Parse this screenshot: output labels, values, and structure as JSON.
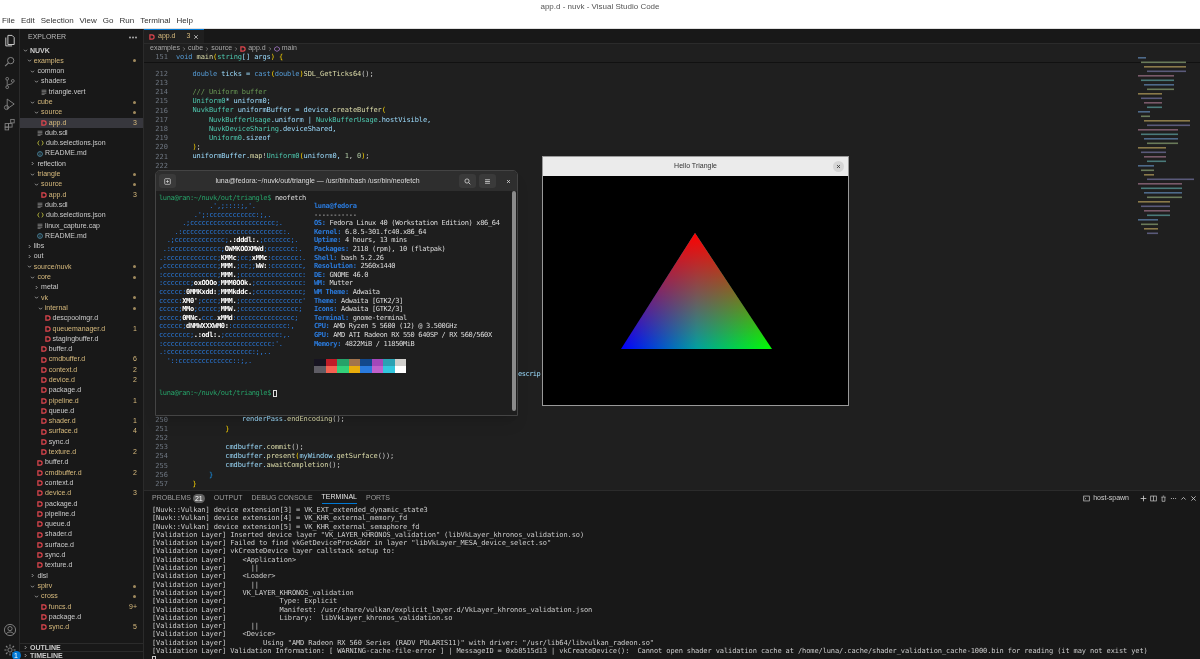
{
  "window": {
    "title": "app.d - nuvk - Visual Studio Code"
  },
  "menu": [
    "File",
    "Edit",
    "Selection",
    "View",
    "Go",
    "Run",
    "Terminal",
    "Help"
  ],
  "activity_bar": [
    {
      "kind": "files",
      "selected": true
    },
    {
      "kind": "search",
      "selected": false
    },
    {
      "kind": "source_control",
      "selected": false
    },
    {
      "kind": "run_debug",
      "selected": false
    },
    {
      "kind": "extensions",
      "selected": false
    }
  ],
  "activity_bottom": [
    {
      "kind": "account"
    },
    {
      "kind": "settings",
      "badge": "1"
    }
  ],
  "sidebar": {
    "title": "EXPLORER",
    "tree": [
      {
        "label": "NUVK",
        "kind": "root",
        "expanded": true,
        "modified": false,
        "selected": false,
        "children": [
          {
            "label": "examples",
            "kind": "folder",
            "expanded": true,
            "modified": true,
            "selected": false,
            "children": [
              {
                "label": "common",
                "kind": "folder",
                "expanded": true,
                "modified": false,
                "selected": false,
                "children": [
                  {
                    "label": "shaders",
                    "kind": "folder",
                    "expanded": true,
                    "modified": false,
                    "selected": false,
                    "children": [
                      {
                        "label": "triangle.vert",
                        "kind": "lines",
                        "modified": false,
                        "selected": false
                      }
                    ]
                  }
                ]
              },
              {
                "label": "cube",
                "kind": "folder",
                "expanded": true,
                "modified": true,
                "selected": false,
                "children": [
                  {
                    "label": "source",
                    "kind": "folder",
                    "expanded": true,
                    "modified": true,
                    "selected": false,
                    "children": [
                      {
                        "label": "app.d",
                        "kind": "d",
                        "modified": true,
                        "selected": true,
                        "badge": "3"
                      }
                    ]
                  },
                  {
                    "label": "dub.sdl",
                    "kind": "lines",
                    "modified": false,
                    "selected": false
                  },
                  {
                    "label": "dub.selections.json",
                    "kind": "json",
                    "modified": false,
                    "selected": false
                  },
                  {
                    "label": "README.md",
                    "kind": "md",
                    "modified": false,
                    "selected": false
                  }
                ]
              },
              {
                "label": "reflection",
                "kind": "folder",
                "expanded": false,
                "modified": false,
                "selected": false
              },
              {
                "label": "triangle",
                "kind": "folder",
                "expanded": true,
                "modified": true,
                "selected": false,
                "children": [
                  {
                    "label": "source",
                    "kind": "folder",
                    "expanded": true,
                    "modified": true,
                    "selected": false,
                    "children": [
                      {
                        "label": "app.d",
                        "kind": "d",
                        "modified": true,
                        "selected": false,
                        "badge": "3"
                      }
                    ]
                  },
                  {
                    "label": "dub.sdl",
                    "kind": "lines",
                    "modified": false,
                    "selected": false
                  },
                  {
                    "label": "dub.selections.json",
                    "kind": "json",
                    "modified": false,
                    "selected": false
                  },
                  {
                    "label": "linux_capture.cap",
                    "kind": "lines",
                    "modified": false,
                    "selected": false
                  },
                  {
                    "label": "README.md",
                    "kind": "md",
                    "modified": false,
                    "selected": false
                  }
                ]
              }
            ]
          },
          {
            "label": "libs",
            "kind": "folder",
            "expanded": false,
            "modified": false,
            "selected": false
          },
          {
            "label": "out",
            "kind": "folder",
            "expanded": false,
            "modified": false,
            "selected": false
          },
          {
            "label": "source/nuvk",
            "kind": "folder",
            "expanded": true,
            "modified": true,
            "selected": false,
            "children": [
              {
                "label": "core",
                "kind": "folder",
                "expanded": true,
                "modified": true,
                "selected": false,
                "children": [
                  {
                    "label": "metal",
                    "kind": "folder",
                    "expanded": false,
                    "modified": false,
                    "selected": false
                  },
                  {
                    "label": "vk",
                    "kind": "folder",
                    "expanded": true,
                    "modified": true,
                    "selected": false,
                    "children": [
                      {
                        "label": "internal",
                        "kind": "folder",
                        "expanded": true,
                        "modified": true,
                        "selected": false,
                        "children": [
                          {
                            "label": "descpoolmgr.d",
                            "kind": "d",
                            "modified": false,
                            "selected": false
                          },
                          {
                            "label": "queuemanager.d",
                            "kind": "d",
                            "modified": true,
                            "selected": false,
                            "badge": "1"
                          },
                          {
                            "label": "stagingbuffer.d",
                            "kind": "d",
                            "modified": false,
                            "selected": false
                          }
                        ]
                      },
                      {
                        "label": "buffer.d",
                        "kind": "d",
                        "modified": false,
                        "selected": false
                      },
                      {
                        "label": "cmdbuffer.d",
                        "kind": "d",
                        "modified": true,
                        "selected": false,
                        "badge": "6"
                      },
                      {
                        "label": "context.d",
                        "kind": "d",
                        "modified": true,
                        "selected": false,
                        "badge": "2"
                      },
                      {
                        "label": "device.d",
                        "kind": "d",
                        "modified": true,
                        "selected": false,
                        "badge": "2"
                      },
                      {
                        "label": "package.d",
                        "kind": "d",
                        "modified": false,
                        "selected": false
                      },
                      {
                        "label": "pipeline.d",
                        "kind": "d",
                        "modified": true,
                        "selected": false,
                        "badge": "1"
                      },
                      {
                        "label": "queue.d",
                        "kind": "d",
                        "modified": false,
                        "selected": false
                      },
                      {
                        "label": "shader.d",
                        "kind": "d",
                        "modified": true,
                        "selected": false,
                        "badge": "1"
                      },
                      {
                        "label": "surface.d",
                        "kind": "d",
                        "modified": true,
                        "selected": false,
                        "badge": "4"
                      },
                      {
                        "label": "sync.d",
                        "kind": "d",
                        "modified": false,
                        "selected": false
                      },
                      {
                        "label": "texture.d",
                        "kind": "d",
                        "modified": true,
                        "selected": false,
                        "badge": "2"
                      }
                    ]
                  },
                  {
                    "label": "buffer.d",
                    "kind": "d",
                    "modified": false,
                    "selected": false
                  },
                  {
                    "label": "cmdbuffer.d",
                    "kind": "d",
                    "modified": true,
                    "selected": false,
                    "badge": "2"
                  },
                  {
                    "label": "context.d",
                    "kind": "d",
                    "modified": false,
                    "selected": false
                  },
                  {
                    "label": "device.d",
                    "kind": "d",
                    "modified": true,
                    "selected": false,
                    "badge": "3"
                  },
                  {
                    "label": "package.d",
                    "kind": "d",
                    "modified": false,
                    "selected": false
                  },
                  {
                    "label": "pipeline.d",
                    "kind": "d",
                    "modified": false,
                    "selected": false
                  },
                  {
                    "label": "queue.d",
                    "kind": "d",
                    "modified": false,
                    "selected": false
                  },
                  {
                    "label": "shader.d",
                    "kind": "d",
                    "modified": false,
                    "selected": false
                  },
                  {
                    "label": "surface.d",
                    "kind": "d",
                    "modified": false,
                    "selected": false
                  },
                  {
                    "label": "sync.d",
                    "kind": "d",
                    "modified": false,
                    "selected": false
                  },
                  {
                    "label": "texture.d",
                    "kind": "d",
                    "modified": false,
                    "selected": false
                  }
                ]
              },
              {
                "label": "dlsl",
                "kind": "folder",
                "expanded": false,
                "modified": false,
                "selected": false
              },
              {
                "label": "spirv",
                "kind": "folder",
                "expanded": true,
                "modified": true,
                "selected": false,
                "children": [
                  {
                    "label": "cross",
                    "kind": "folder",
                    "expanded": true,
                    "modified": true,
                    "selected": false,
                    "children": [
                      {
                        "label": "funcs.d",
                        "kind": "d",
                        "modified": true,
                        "selected": false,
                        "badge": "9+"
                      },
                      {
                        "label": "package.d",
                        "kind": "d",
                        "modified": false,
                        "selected": false
                      },
                      {
                        "label": "sync.d",
                        "kind": "d",
                        "modified": true,
                        "selected": false,
                        "badge": "5"
                      }
                    ]
                  }
                ]
              }
            ]
          }
        ]
      }
    ],
    "sections": [
      {
        "label": "OUTLINE",
        "expanded": false
      },
      {
        "label": "TIMELINE",
        "expanded": false
      }
    ]
  },
  "editor": {
    "tabs": [
      {
        "label": "app.d",
        "badge": "3",
        "modified": true,
        "selected": true
      }
    ],
    "breadcrumb": [
      {
        "label": "examples",
        "kind": "folder"
      },
      {
        "label": "cube",
        "kind": "folder"
      },
      {
        "label": "source",
        "kind": "folder"
      },
      {
        "label": "app.d",
        "kind": "d"
      },
      {
        "label": "main",
        "kind": "symbol"
      }
    ],
    "sticky": {
      "number": "151",
      "tokens": [
        {
          "text": "void",
          "kind": "kw"
        },
        {
          "text": " main",
          "kind": "fn"
        },
        {
          "text": "(",
          "kind": "b"
        },
        {
          "text": "string",
          "kind": "type"
        },
        {
          "text": "[] args",
          "kind": "var"
        },
        {
          "text": ") {",
          "kind": "b"
        }
      ]
    },
    "lines": [
      {
        "number": "212",
        "tokens": [
          {
            "text": "    double",
            "kind": "kw"
          },
          {
            "text": " ticks = ",
            "kind": "var"
          },
          {
            "text": "cast",
            "kind": "kw"
          },
          {
            "text": "(",
            "kind": "b"
          },
          {
            "text": "double",
            "kind": "kw"
          },
          {
            "text": ")",
            "kind": "b"
          },
          {
            "text": "SDL_GetTicks64",
            "kind": "fn"
          },
          {
            "text": "();",
            "kind": "p"
          }
        ]
      },
      {
        "number": "213"
      },
      {
        "number": "214",
        "tokens": [
          {
            "text": "    /// Uniform buffer",
            "kind": "cm"
          }
        ]
      },
      {
        "number": "215",
        "tokens": [
          {
            "text": "    Uniform0",
            "kind": "type"
          },
          {
            "text": "* uniform0;",
            "kind": "var"
          }
        ]
      },
      {
        "number": "216",
        "tokens": [
          {
            "text": "    NuvkBuffer",
            "kind": "type"
          },
          {
            "text": " uniformBuffer = device.",
            "kind": "var"
          },
          {
            "text": "createBuffer",
            "kind": "fn"
          },
          {
            "text": "(",
            "kind": "b"
          }
        ]
      },
      {
        "number": "217",
        "tokens": [
          {
            "text": "        NuvkBufferUsage",
            "kind": "type"
          },
          {
            "text": ".uniform | ",
            "kind": "var"
          },
          {
            "text": "NuvkBufferUsage",
            "kind": "type"
          },
          {
            "text": ".hostVisible,",
            "kind": "var"
          }
        ]
      },
      {
        "number": "218",
        "tokens": [
          {
            "text": "        NuvkDeviceSharing",
            "kind": "type"
          },
          {
            "text": ".deviceShared,",
            "kind": "var"
          }
        ]
      },
      {
        "number": "219",
        "tokens": [
          {
            "text": "        Uniform0",
            "kind": "type"
          },
          {
            "text": ".sizeof",
            "kind": "var"
          }
        ]
      },
      {
        "number": "220",
        "tokens": [
          {
            "text": "    )",
            "kind": "b"
          },
          {
            "text": ";",
            "kind": "p"
          }
        ]
      },
      {
        "number": "221",
        "tokens": [
          {
            "text": "    uniformBuffer.",
            "kind": "var"
          },
          {
            "text": "map",
            "kind": "fn"
          },
          {
            "text": "!",
            "kind": "p"
          },
          {
            "text": "Uniform0",
            "kind": "type"
          },
          {
            "text": "(",
            "kind": "b"
          },
          {
            "text": "uniform0, ",
            "kind": "var"
          },
          {
            "text": "1",
            "kind": "num"
          },
          {
            "text": ", ",
            "kind": "p"
          },
          {
            "text": "0",
            "kind": "num"
          },
          {
            "text": ")",
            "kind": "b"
          },
          {
            "text": ";",
            "kind": "p"
          }
        ]
      },
      {
        "number": "222"
      }
    ],
    "lower_lines": [
      {
        "number": "250",
        "tokens": [
          {
            "text": "                renderPass.",
            "kind": "var"
          },
          {
            "text": "endEncoding",
            "kind": "fn"
          },
          {
            "text": "();",
            "kind": "p"
          }
        ]
      },
      {
        "number": "251",
        "tokens": [
          {
            "text": "            }",
            "kind": "b"
          }
        ]
      },
      {
        "number": "252"
      },
      {
        "number": "253",
        "tokens": [
          {
            "text": "            cmdbuffer.",
            "kind": "var"
          },
          {
            "text": "commit",
            "kind": "fn"
          },
          {
            "text": "();",
            "kind": "p"
          }
        ]
      },
      {
        "number": "254",
        "tokens": [
          {
            "text": "            cmdbuffer.",
            "kind": "var"
          },
          {
            "text": "present",
            "kind": "fn"
          },
          {
            "text": "(",
            "kind": "b"
          },
          {
            "text": "myWindow.",
            "kind": "var"
          },
          {
            "text": "getSurface",
            "kind": "fn"
          },
          {
            "text": "());",
            "kind": "p"
          }
        ]
      },
      {
        "number": "255",
        "tokens": [
          {
            "text": "            cmdbuffer.",
            "kind": "var"
          },
          {
            "text": "awaitCompletion",
            "kind": "fn"
          },
          {
            "text": "();",
            "kind": "p"
          }
        ]
      },
      {
        "number": "256",
        "tokens": [
          {
            "text": "        }",
            "kind": "b2"
          }
        ]
      },
      {
        "number": "257",
        "tokens": [
          {
            "text": "    }",
            "kind": "b"
          }
        ]
      }
    ],
    "fragment": "escrip"
  },
  "terminal_window": {
    "title": "luna@fedora:~/nuvk/out/triangle — /usr/bin/bash /usr/bin/neofetch",
    "prompts": [
      {
        "prompt": "luna@ran:~/nuvk/out/triangle$",
        "command": "neofetch"
      },
      {
        "prompt": "luna@ran:~/nuvk/out/triangle$"
      }
    ],
    "art": [
      [
        "             .',;::::;,'."
      ],
      [
        "         .';:cccccccccccc:;,."
      ],
      [
        "      .;cccccccccccccccccccccc;."
      ],
      [
        "    .:cccccccccccccccccccccccccc:."
      ],
      [
        "  .;ccccccccccccc;",
        ".:dddl:.",
        ";ccccccc;."
      ],
      [
        " .:ccccccccccccc;",
        "OWMKOOXMWd",
        ";ccccccc:."
      ],
      [
        ".:ccccccccccccc;",
        "KMMc",
        ";cc;",
        "xMMc",
        ":ccccccc:."
      ],
      [
        ",cccccccccccccc;",
        "MMM.",
        ";cc;;",
        "WW:",
        ":cccccccc,"
      ],
      [
        ":cccccccccccccc;",
        "MMM.",
        ";cccccccccccccccc:"
      ],
      [
        ":ccccccc;",
        "oxOOOo",
        ";",
        "MMM0OOk.",
        ";cccccccccccc:"
      ],
      [
        "cccccc:",
        "0MMKxdd:",
        ";",
        "MMMkddc.",
        ";cccccccccccc;"
      ],
      [
        "ccccc:",
        "XM0'",
        ";cccc;",
        "MMM.",
        ";cccccccccccccccc'"
      ],
      [
        "ccccc;",
        "MMo",
        ";ccccc;",
        "MMW.",
        ";ccccccccccccccc;"
      ],
      [
        "ccccc;",
        "0MNc.",
        "ccc.",
        "xMMd",
        ":ccccccccccccccc;"
      ],
      [
        "cccccc;",
        "dNMWXXXWM0:",
        ":cccccccccccccc:,"
      ],
      [
        "cccccccc;",
        ".:odl:.",
        ";cccccccccccccc:,."
      ],
      [
        ":cccccccccccccccccccccccccccc:'."
      ],
      [
        ".:cccccccccccccccccccccc:;,.."
      ],
      [
        "  '::cccccccccccccc::;,."
      ]
    ],
    "user": "luna@fedora",
    "rule": "-----------",
    "info": [
      {
        "key": "OS:",
        "value": "Fedora Linux 40 (Workstation Edition) x86_64"
      },
      {
        "key": "Kernel:",
        "value": "6.8.5-301.fc40.x86_64"
      },
      {
        "key": "Uptime:",
        "value": "4 hours, 13 mins"
      },
      {
        "key": "Packages:",
        "value": "2118 (rpm), 10 (flatpak)"
      },
      {
        "key": "Shell:",
        "value": "bash 5.2.26"
      },
      {
        "key": "Resolution:",
        "value": "2560x1440"
      },
      {
        "key": "DE:",
        "value": "GNOME 46.0"
      },
      {
        "key": "WM:",
        "value": "Mutter"
      },
      {
        "key": "WM Theme:",
        "value": "Adwaita"
      },
      {
        "key": "Theme:",
        "value": "Adwaita [GTK2/3]"
      },
      {
        "key": "Icons:",
        "value": "Adwaita [GTK2/3]"
      },
      {
        "key": "Terminal:",
        "value": "gnome-terminal"
      },
      {
        "key": "CPU:",
        "value": "AMD Ryzen 5 5600 (12) @ 3.500GHz"
      },
      {
        "key": "GPU:",
        "value": "AMD ATI Radeon RX 550 640SP / RX 560/560X"
      },
      {
        "key": "Memory:",
        "value": "4822MiB / 11850MiB"
      }
    ],
    "palette": [
      {
        "color": "#171421"
      },
      {
        "color": "#c01c28"
      },
      {
        "color": "#26a269"
      },
      {
        "color": "#a2734c"
      },
      {
        "color": "#12488b"
      },
      {
        "color": "#a347ba"
      },
      {
        "color": "#2aa1b3"
      },
      {
        "color": "#d0cfcc"
      },
      {
        "color": "#5e5c64"
      },
      {
        "color": "#f66151"
      },
      {
        "color": "#33d17a"
      },
      {
        "color": "#e9ad0c"
      },
      {
        "color": "#2a7bde"
      },
      {
        "color": "#c061cb"
      },
      {
        "color": "#33c7de"
      },
      {
        "color": "#ffffff"
      }
    ]
  },
  "hello_window": {
    "title": "Hello Triangle"
  },
  "panel": {
    "tabs": [
      {
        "label": "PROBLEMS",
        "badge": "21",
        "selected": false
      },
      {
        "label": "OUTPUT",
        "selected": false
      },
      {
        "label": "DEBUG CONSOLE",
        "selected": false
      },
      {
        "label": "TERMINAL",
        "selected": true
      },
      {
        "label": "PORTS",
        "selected": false
      }
    ],
    "terminal_name": "host-spawn",
    "lines": [
      "[Nuvk::Vulkan] device extension[3] = VK_EXT_extended_dynamic_state3",
      "[Nuvk::Vulkan] device extension[4] = VK_KHR_external_memory_fd",
      "[Nuvk::Vulkan] device extension[5] = VK_KHR_external_semaphore_fd",
      "[Validation Layer] Inserted device layer \"VK_LAYER_KHRONOS_validation\" (libVkLayer_khronos_validation.so)",
      "[Validation Layer] Failed to find vkGetDeviceProcAddr in layer \"libVkLayer_MESA_device_select.so\"",
      "[Validation Layer] vkCreateDevice layer callstack setup to:",
      "[Validation Layer]    <Application>",
      "[Validation Layer]      ||",
      "[Validation Layer]    <Loader>",
      "[Validation Layer]      ||",
      "[Validation Layer]    VK_LAYER_KHRONOS_validation",
      "[Validation Layer]             Type: Explicit",
      "[Validation Layer]             Manifest: /usr/share/vulkan/explicit_layer.d/VkLayer_khronos_validation.json",
      "[Validation Layer]             Library:  libVkLayer_khronos_validation.so",
      "[Validation Layer]      ||",
      "[Validation Layer]    <Device>",
      "[Validation Layer]         Using \"AMD Radeon RX 560 Series (RADV POLARIS11)\" with driver: \"/usr/lib64/libvulkan_radeon.so\"",
      "[Validation Layer] Validation Information: [ WARNING-cache-file-error ] | MessageID = 0xb8515d13 | vkCreateDevice():  Cannot open shader validation cache at /home/luna/.cache/shader_validation_cache-1000.bin for reading (it may not exist yet)"
    ]
  }
}
